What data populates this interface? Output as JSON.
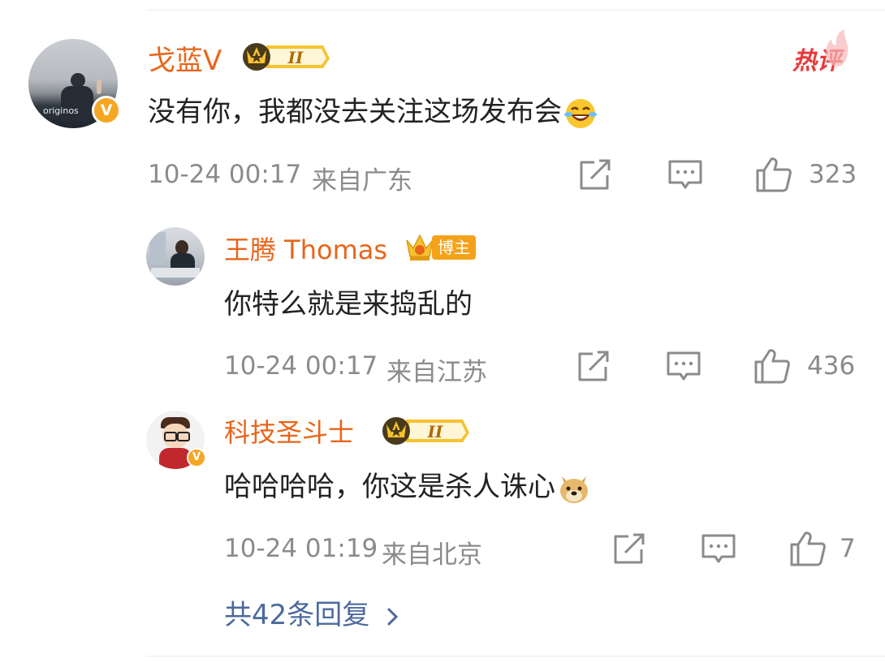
{
  "hot_label": "热评",
  "main_comment": {
    "username": "戈蓝V",
    "level": "II",
    "text": "没有你，我都没去关注这场发布会",
    "emoji": "laugh-cry-emoji",
    "timestamp": "10-24 00:17",
    "location": "来自广东",
    "likes": "323",
    "avatar_text": "originos"
  },
  "replies": [
    {
      "username": "王腾 Thomas",
      "badge_label": "博主",
      "text": "你特么就是来捣乱的",
      "timestamp": "10-24 00:17",
      "location": "来自江苏",
      "likes": "436"
    },
    {
      "username": "科技圣斗士",
      "level": "II",
      "text": "哈哈哈哈，你这是杀人诛心",
      "emoji": "doge-emoji",
      "timestamp": "10-24 01:19",
      "location": "来自北京",
      "likes": "7"
    }
  ],
  "more_replies": "共42条回复",
  "colors": {
    "username": "#e8651a",
    "link": "#4c6a9c",
    "meta": "#8b8b8b",
    "vbadge": "#f5a623"
  }
}
